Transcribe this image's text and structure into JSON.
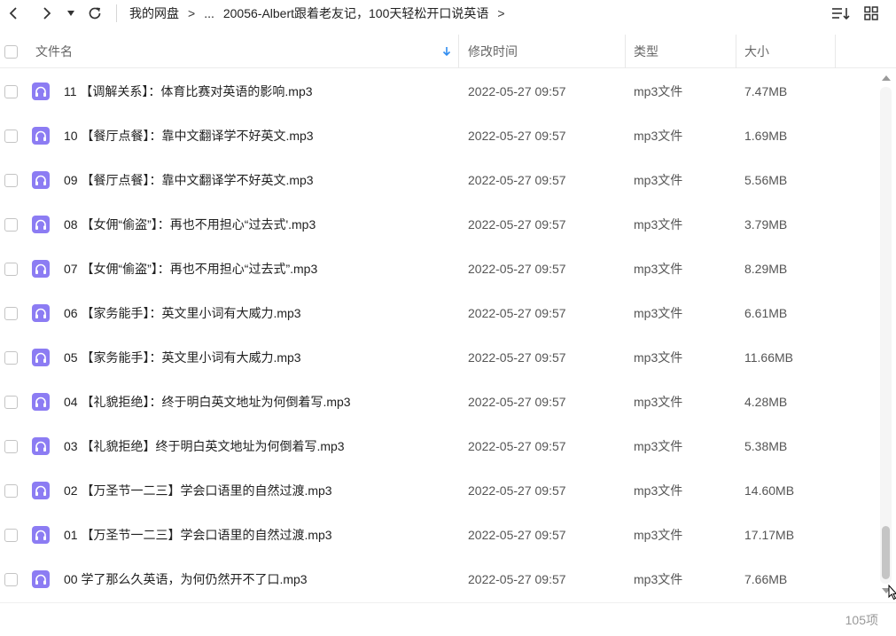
{
  "nav": {
    "breadcrumb": [
      "我的网盘",
      "...",
      "20056-Albert跟着老友记，100天轻松开口说英语"
    ],
    "separator": ">",
    "trailing_separator": ">"
  },
  "columns": {
    "name": "文件名",
    "modified": "修改时间",
    "type": "类型",
    "size": "大小"
  },
  "files": [
    {
      "name": "11 【调解关系】：体育比赛对英语的影响.mp3",
      "modified": "2022-05-27 09:57",
      "type": "mp3文件",
      "size": "7.47MB"
    },
    {
      "name": "10 【餐厅点餐】：靠中文翻译学不好英文.mp3",
      "modified": "2022-05-27 09:57",
      "type": "mp3文件",
      "size": "1.69MB"
    },
    {
      "name": "09 【餐厅点餐】：靠中文翻译学不好英文.mp3",
      "modified": "2022-05-27 09:57",
      "type": "mp3文件",
      "size": "5.56MB"
    },
    {
      "name": "08 【女佣“偷盗”】：再也不用担心“过去式'.mp3",
      "modified": "2022-05-27 09:57",
      "type": "mp3文件",
      "size": "3.79MB"
    },
    {
      "name": "07 【女佣“偷盗”】：再也不用担心“过去式”.mp3",
      "modified": "2022-05-27 09:57",
      "type": "mp3文件",
      "size": "8.29MB"
    },
    {
      "name": "06 【家务能手】：英文里小词有大威力.mp3",
      "modified": "2022-05-27 09:57",
      "type": "mp3文件",
      "size": "6.61MB"
    },
    {
      "name": "05 【家务能手】：英文里小词有大威力.mp3",
      "modified": "2022-05-27 09:57",
      "type": "mp3文件",
      "size": "11.66MB"
    },
    {
      "name": "04 【礼貌拒绝】：终于明白英文地址为何倒着写.mp3",
      "modified": "2022-05-27 09:57",
      "type": "mp3文件",
      "size": "4.28MB"
    },
    {
      "name": "03 【礼貌拒绝】终于明白英文地址为何倒着写.mp3",
      "modified": "2022-05-27 09:57",
      "type": "mp3文件",
      "size": "5.38MB"
    },
    {
      "name": "02 【万圣节一二三】学会口语里的自然过渡.mp3",
      "modified": "2022-05-27 09:57",
      "type": "mp3文件",
      "size": "14.60MB"
    },
    {
      "name": "01 【万圣节一二三】学会口语里的自然过渡.mp3",
      "modified": "2022-05-27 09:57",
      "type": "mp3文件",
      "size": "17.17MB"
    },
    {
      "name": "00 学了那么久英语，为何仍然开不了口.mp3",
      "modified": "2022-05-27 09:57",
      "type": "mp3文件",
      "size": "7.66MB"
    }
  ],
  "footer": {
    "count": "105项"
  },
  "icons": {
    "file": "headphones-icon",
    "accent": "#8c7cf3",
    "sort_arrow_color": "#2f8cf0"
  }
}
